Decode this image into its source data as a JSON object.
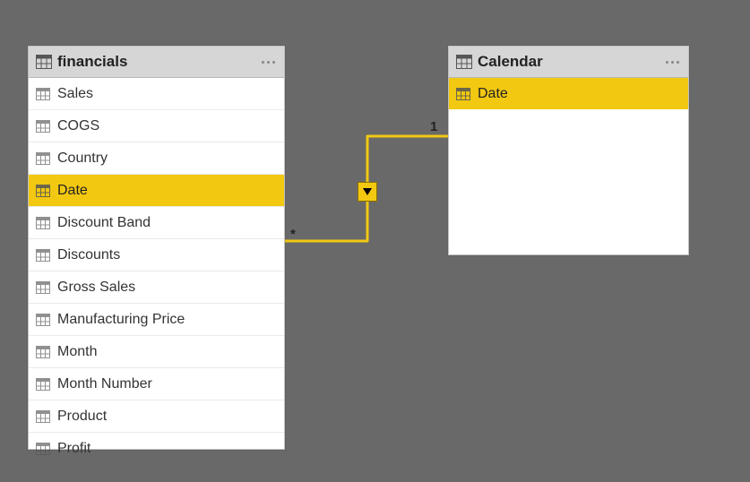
{
  "tables": {
    "financials": {
      "title": "financials",
      "fields": [
        {
          "label": "Sales"
        },
        {
          "label": "COGS"
        },
        {
          "label": "Country"
        },
        {
          "label": "Date",
          "highlight": true
        },
        {
          "label": "Discount Band"
        },
        {
          "label": "Discounts"
        },
        {
          "label": "Gross Sales"
        },
        {
          "label": "Manufacturing Price"
        },
        {
          "label": "Month"
        },
        {
          "label": "Month Number"
        },
        {
          "label": "Product"
        },
        {
          "label": "Profit"
        }
      ]
    },
    "calendar": {
      "title": "Calendar",
      "fields": [
        {
          "label": "Date",
          "highlight": true
        }
      ]
    }
  },
  "relationship": {
    "left_cardinality": "*",
    "right_cardinality": "1",
    "direction": "single"
  },
  "colors": {
    "highlight": "#f2c811",
    "canvas": "#696969"
  }
}
